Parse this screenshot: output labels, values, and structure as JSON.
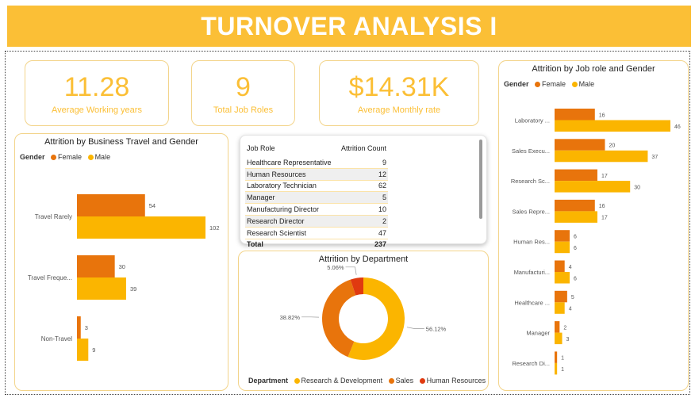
{
  "title": "TURNOVER ANALYSIS I",
  "kpis": [
    {
      "value": "11.28",
      "label": "Average Working years"
    },
    {
      "value": "9",
      "label": "Total Job Roles"
    },
    {
      "value": "$14.31K",
      "label": "Average Monthly rate"
    }
  ],
  "colors": {
    "female": "#e8740c",
    "male": "#fbb500",
    "hr": "#e03a10",
    "accent": "#fbbf36"
  },
  "legend": {
    "gender_title": "Gender",
    "female": "Female",
    "male": "Male",
    "department_title": "Department"
  },
  "table": {
    "headers": [
      "Job Role",
      "Attrition Count"
    ],
    "rows": [
      {
        "role": "Healthcare Representative",
        "count": "9"
      },
      {
        "role": "Human Resources",
        "count": "12"
      },
      {
        "role": "Laboratory Technician",
        "count": "62"
      },
      {
        "role": "Manager",
        "count": "5"
      },
      {
        "role": "Manufacturing Director",
        "count": "10"
      },
      {
        "role": "Research Director",
        "count": "2"
      },
      {
        "role": "Research Scientist",
        "count": "47"
      }
    ],
    "total_label": "Total",
    "total": "237"
  },
  "chart_data": [
    {
      "type": "bar",
      "orientation": "horizontal",
      "title": "Attrition by Business Travel and Gender",
      "categories": [
        "Travel Rarely",
        "Travel Freque...",
        "Non-Travel"
      ],
      "series": [
        {
          "name": "Female",
          "values": [
            54,
            30,
            3
          ]
        },
        {
          "name": "Male",
          "values": [
            102,
            39,
            9
          ]
        }
      ],
      "legend_position": "top-left",
      "grid": false
    },
    {
      "type": "pie",
      "variant": "donut",
      "title": "Attrition by Department",
      "labels": [
        "Research & Development",
        "Sales",
        "Human Resources"
      ],
      "values": [
        56.12,
        38.82,
        5.06
      ],
      "value_labels": [
        "56.12%",
        "38.82%",
        "5.06%"
      ],
      "legend_position": "bottom"
    },
    {
      "type": "bar",
      "orientation": "horizontal",
      "title": "Attrition by Job role and Gender",
      "categories": [
        "Laboratory ...",
        "Sales Execu...",
        "Research Sc...",
        "Sales Repre...",
        "Human Res...",
        "Manufacturi...",
        "Healthcare ...",
        "Manager",
        "Research Di..."
      ],
      "series": [
        {
          "name": "Female",
          "values": [
            16,
            20,
            17,
            16,
            6,
            4,
            5,
            2,
            1
          ]
        },
        {
          "name": "Male",
          "values": [
            46,
            37,
            30,
            17,
            6,
            6,
            4,
            3,
            1
          ]
        }
      ],
      "legend_position": "top-left",
      "grid": false
    }
  ]
}
